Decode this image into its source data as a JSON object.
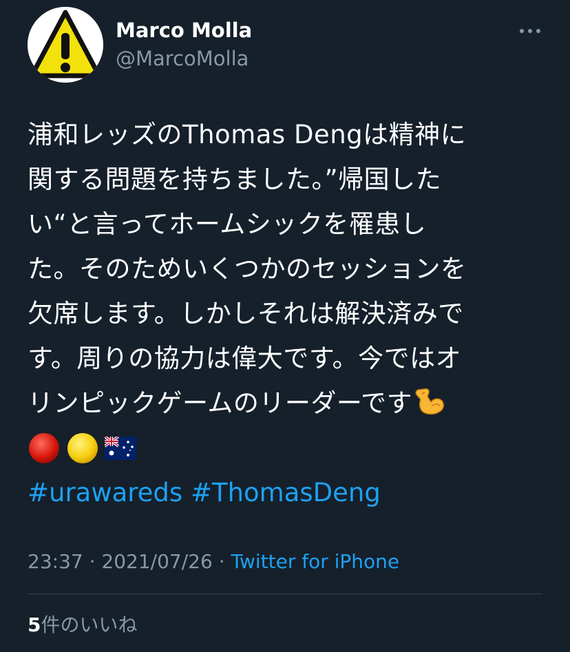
{
  "author": {
    "display_name": "Marco Molla",
    "handle": "@MarcoMolla",
    "avatar_icon": "warning-sign-icon"
  },
  "more_icon": "more-horizontal-icon",
  "tweet": {
    "lines": [
      "浦和レッズのThomas Dengは精神に",
      "関する問題を持ちました。”帰国した",
      "い“と言ってホームシックを罹患し",
      "た。そのためいくつかのセッションを",
      "欠席します。しかしそれは解決済みで",
      "す。周りの協力は偉大です。今ではオ",
      "リンピックゲームのリーダーです"
    ],
    "emojis": [
      "flexed-biceps",
      "red-circle",
      "yellow-circle",
      "australia-flag"
    ],
    "hashtags": [
      "#urawareds",
      "#ThomasDeng"
    ]
  },
  "meta": {
    "time": "23:37",
    "separator": " · ",
    "date": "2021/07/26",
    "source": "Twitter for iPhone"
  },
  "likes": {
    "count": "5",
    "label": "件のいいね"
  },
  "colors": {
    "background": "#15202b",
    "link": "#1da1f2",
    "secondary_text": "#8899a6",
    "divider": "#38444d"
  }
}
